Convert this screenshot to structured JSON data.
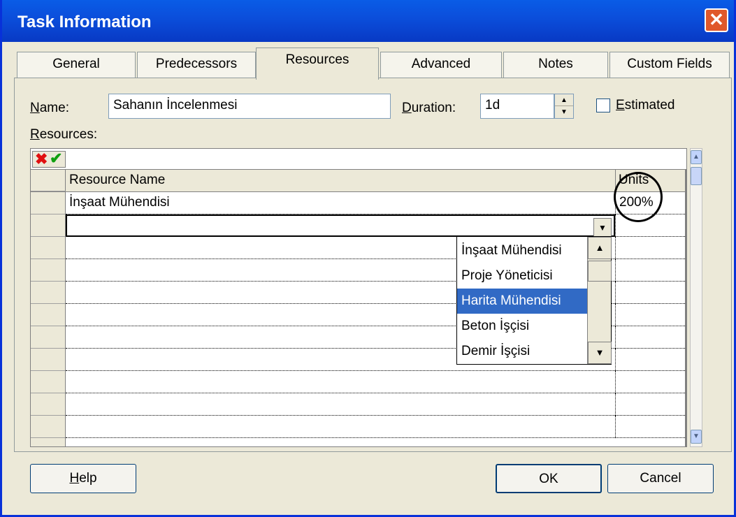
{
  "window": {
    "title": "Task Information"
  },
  "tabs": [
    {
      "label": "General"
    },
    {
      "label": "Predecessors"
    },
    {
      "label": "Resources"
    },
    {
      "label": "Advanced"
    },
    {
      "label": "Notes"
    },
    {
      "label": "Custom Fields"
    }
  ],
  "form": {
    "name_label": "Name:",
    "name_value": "Sahanın İncelenmesi",
    "duration_label": "Duration:",
    "duration_value": "1d",
    "estimated_label": "Estimated",
    "resources_label": "Resources:"
  },
  "grid": {
    "col_name": "Resource Name",
    "col_units": "Units",
    "rows": [
      {
        "name": "İnşaat Mühendisi",
        "units": "200%"
      }
    ]
  },
  "dropdown": {
    "items": [
      "İnşaat Mühendisi",
      "Proje Yöneticisi",
      "Harita Mühendisi",
      "Beton İşçisi",
      "Demir İşçisi"
    ],
    "selected": "Harita Mühendisi"
  },
  "buttons": {
    "help": "Help",
    "ok": "OK",
    "cancel": "Cancel"
  },
  "colors": {
    "title_bar": "#0b4fdc",
    "selection": "#316ac5",
    "close": "#e0582a"
  }
}
